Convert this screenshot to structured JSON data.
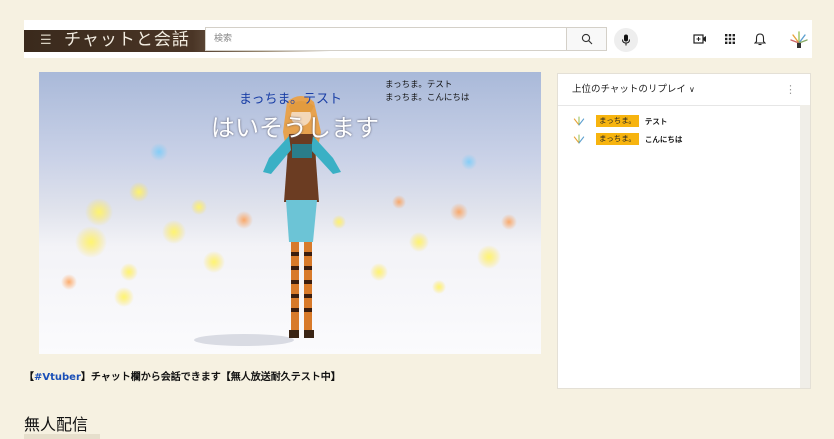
{
  "header": {
    "banner_title": "チャットと会話",
    "search_placeholder": "検索"
  },
  "video": {
    "overlay_name": "まっちま。テスト",
    "overlay_speech": "はいそうします",
    "overlay_chat": [
      "まっちま。テスト",
      "まっちま。こんにちは"
    ],
    "title_tag": "#Vtuber",
    "title_pre": "【",
    "title_post": "】チャット欄から会話できます【無人放送耐久テスト中】"
  },
  "chat": {
    "header_label": "上位のチャットのリプレイ",
    "messages": [
      {
        "author": "まっちま。",
        "text": "テスト"
      },
      {
        "author": "まっちま。",
        "text": "こんにちは"
      }
    ]
  },
  "section": {
    "title": "無人配信"
  },
  "colors": {
    "page_bg": "#f6f1e1",
    "badge": "#f7b40f",
    "link": "#1a4fb7"
  }
}
